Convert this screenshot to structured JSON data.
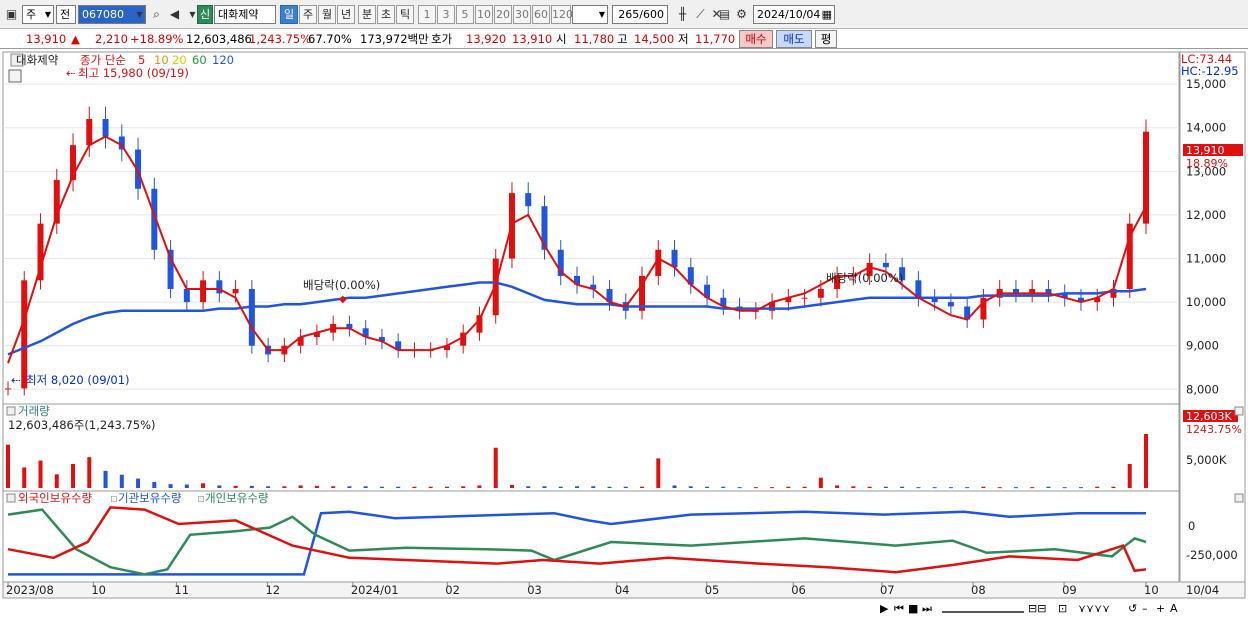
{
  "toolbar": {
    "market_type": "주",
    "market_scope": "전",
    "code": "067080",
    "stock_badge": "신",
    "stock_name": "대화제약",
    "periods": [
      "일",
      "주",
      "월",
      "년",
      "분",
      "초",
      "틱"
    ],
    "active_period": "일",
    "intervals": [
      "1",
      "3",
      "5",
      "10",
      "20",
      "30",
      "60",
      "120"
    ],
    "count": "265",
    "count_total": "/600",
    "date": "2024/10/04"
  },
  "quote": {
    "price": "13,910",
    "change_arrow": "▲",
    "change": "2,210",
    "change_pct": "+18.89%",
    "volume": "12,603,486",
    "volume_pct": "1,243.75%",
    "turnover_pct": "67.70%",
    "amount": "173,972백만",
    "ask_label": "호가",
    "ask": "13,920",
    "bid": "13,910",
    "open_label": "시",
    "open": "11,780",
    "high_label": "고",
    "high": "14,500",
    "low_label": "저",
    "low": "11,770",
    "buy_button": "매수",
    "sell_button": "매도",
    "eval_button": "평"
  },
  "price_panel": {
    "stock_name": "대화제약",
    "ma_legend": {
      "prefix": "종가 단순",
      "ma5": "5",
      "ma10": "10",
      "ma20": "20",
      "ma60": "60",
      "ma120": "120"
    },
    "ma_colors": {
      "ma5": "#e01010",
      "ma10": "#f08c10",
      "ma20": "#f5e020",
      "ma60": "#1f9a3a",
      "ma120": "#2255dd"
    },
    "high_label": "최고 15,980 (09/19)",
    "low_label": "최저 8,020 (09/01)",
    "dividend_label_1": "배당락(0.00%)",
    "dividend_label_2": "배당락(0.00%)",
    "lc": "LC:73.44",
    "hc": "HC:-12.95",
    "y_ticks": [
      "15,000",
      "14,000",
      "13,000",
      "12,000",
      "11,000",
      "10,000",
      "9,000",
      "8,000"
    ],
    "last_price_tag": "13,910",
    "last_pct_tag": "18.89%"
  },
  "volume_panel": {
    "title": "거래량",
    "value": "12,603,486주(1,243.75%)",
    "y_tick": "5,000K",
    "last_tag": "12,603K",
    "last_pct_tag": "1243.75%"
  },
  "holding_panel": {
    "legend_foreign": "외국인보유수량",
    "legend_institution": "기관보유수량",
    "legend_individual": "개인보유수량",
    "colors": {
      "foreign": "#e01010",
      "institution": "#2255dd",
      "individual": "#2e8b57"
    },
    "y_ticks": [
      "0",
      "-250,000"
    ]
  },
  "x_axis": {
    "labels": [
      "2023/08",
      "10",
      "11",
      "12",
      "2024/01",
      "02",
      "03",
      "04",
      "05",
      "06",
      "07",
      "08",
      "09",
      "10"
    ],
    "right_label": "10/04"
  },
  "chart_data": {
    "type": "candlestick",
    "title": "대화제약",
    "price_range": [
      7800,
      15600
    ],
    "volume_max_k": 12603,
    "price": [
      8020,
      10500,
      11800,
      12800,
      13600,
      14200,
      13800,
      13500,
      12600,
      11200,
      10300,
      10000,
      10500,
      10200,
      10300,
      9000,
      8800,
      9000,
      9200,
      9300,
      9500,
      9400,
      9200,
      9100,
      8900,
      8900,
      8900,
      9000,
      9300,
      9700,
      11000,
      12500,
      12200,
      11200,
      10600,
      10400,
      10300,
      10000,
      9800,
      10600,
      11200,
      10800,
      10400,
      10100,
      9900,
      9800,
      9800,
      10000,
      10100,
      10100,
      10300,
      10600,
      10600,
      10900,
      10800,
      10500,
      10100,
      10000,
      9900,
      9600,
      10100,
      10300,
      10200,
      10300,
      10200,
      10100,
      10000,
      10100,
      10300,
      11800,
      13910
    ],
    "ma5": [
      8600,
      9600,
      10800,
      12000,
      12900,
      13600,
      13800,
      13600,
      13000,
      12000,
      11000,
      10300,
      10300,
      10300,
      10100,
      9400,
      8900,
      8900,
      9200,
      9300,
      9400,
      9400,
      9200,
      9100,
      8900,
      8900,
      8900,
      9000,
      9200,
      9600,
      10400,
      11800,
      12000,
      11300,
      10700,
      10400,
      10300,
      10000,
      9900,
      10400,
      11000,
      10800,
      10400,
      10100,
      9900,
      9800,
      9800,
      10000,
      10100,
      10200,
      10400,
      10600,
      10600,
      10800,
      10700,
      10400,
      10100,
      9900,
      9700,
      9600,
      10000,
      10200,
      10200,
      10200,
      10200,
      10100,
      10000,
      10100,
      10300,
      11500,
      12200
    ],
    "ma120": [
      8800,
      8950,
      9100,
      9300,
      9500,
      9650,
      9750,
      9800,
      9800,
      9800,
      9800,
      9800,
      9800,
      9850,
      9850,
      9900,
      9900,
      9950,
      9950,
      10000,
      10050,
      10100,
      10100,
      10150,
      10200,
      10250,
      10300,
      10350,
      10400,
      10450,
      10450,
      10350,
      10200,
      10050,
      10000,
      9950,
      9950,
      9950,
      9900,
      9900,
      9900,
      9900,
      9900,
      9900,
      9850,
      9850,
      9850,
      9850,
      9850,
      9900,
      9950,
      10000,
      10050,
      10100,
      10100,
      10100,
      10100,
      10100,
      10100,
      10100,
      10150,
      10150,
      10150,
      10150,
      10150,
      10200,
      10200,
      10200,
      10250,
      10250,
      10300
    ],
    "volume_k": [
      10100,
      4800,
      6400,
      3200,
      5600,
      7200,
      4000,
      3100,
      2200,
      1400,
      900,
      800,
      1100,
      600,
      500,
      500,
      400,
      400,
      600,
      500,
      400,
      400,
      400,
      300,
      300,
      300,
      300,
      300,
      400,
      600,
      9400,
      700,
      400,
      400,
      300,
      400,
      400,
      300,
      300,
      300,
      6900,
      600,
      400,
      300,
      300,
      200,
      200,
      200,
      300,
      300,
      2400,
      600,
      400,
      300,
      300,
      300,
      200,
      200,
      200,
      200,
      300,
      200,
      200,
      200,
      300,
      200,
      200,
      300,
      300,
      5600,
      12603
    ]
  }
}
